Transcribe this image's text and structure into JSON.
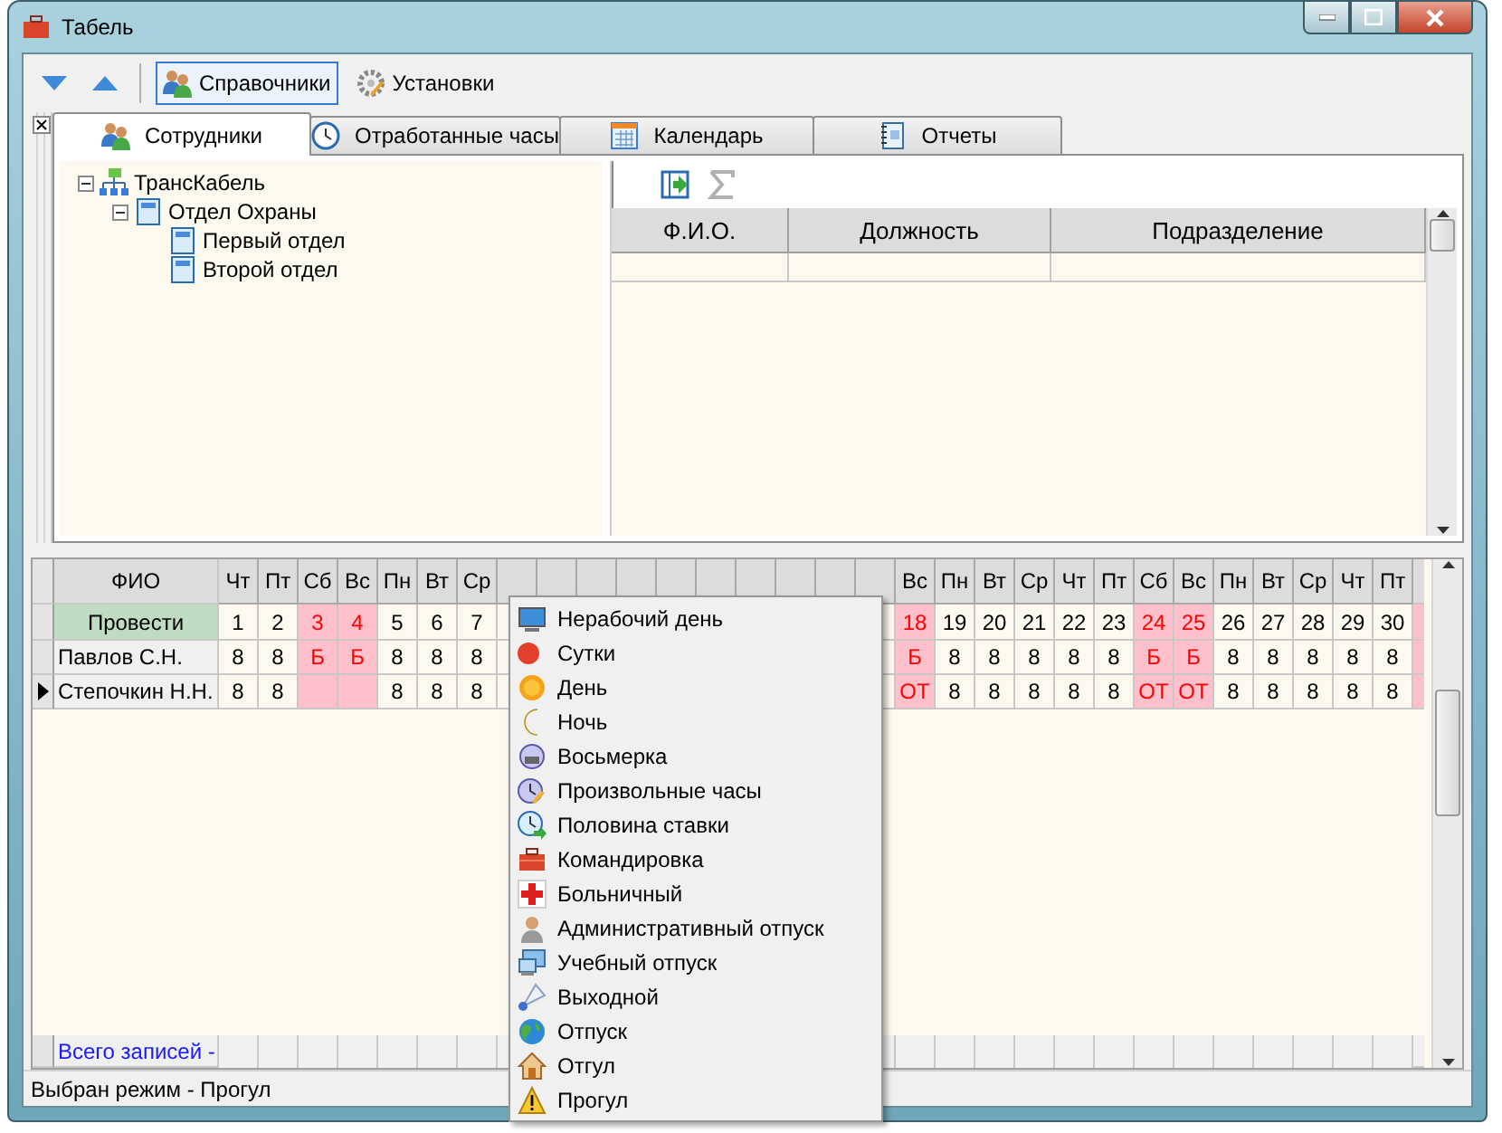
{
  "window": {
    "title": "Табель"
  },
  "toolbar": {
    "buttons": [
      {
        "label": "Справочники",
        "selected": true
      },
      {
        "label": "Установки",
        "selected": false
      }
    ]
  },
  "tabs": [
    {
      "label": "Сотрудники",
      "selected": true
    },
    {
      "label": "Отработанные часы",
      "selected": false
    },
    {
      "label": "Календарь",
      "selected": false
    },
    {
      "label": "Отчеты",
      "selected": false
    }
  ],
  "tree": [
    {
      "label": "ТрансКабель",
      "expanded": true,
      "children": [
        {
          "label": "Отдел Охраны",
          "expanded": true,
          "children": [
            {
              "label": "Первый отдел"
            },
            {
              "label": "Второй отдел"
            }
          ]
        }
      ]
    }
  ],
  "employees_table": {
    "columns": [
      "Ф.И.О.",
      "Должность",
      "Подразделение"
    ]
  },
  "timesheet": {
    "name_header": "ФИО",
    "post_label": "Провести",
    "columns": [
      {
        "header": "Чт",
        "date": "1",
        "weekend": false
      },
      {
        "header": "Пт",
        "date": "2",
        "weekend": false
      },
      {
        "header": "Сб",
        "date": "3",
        "weekend": true
      },
      {
        "header": "Вс",
        "date": "4",
        "weekend": true
      },
      {
        "header": "Пн",
        "date": "5",
        "weekend": false
      },
      {
        "header": "Вт",
        "date": "6",
        "weekend": false
      },
      {
        "header": "Ср",
        "date": "7",
        "weekend": false
      },
      null,
      null,
      null,
      null,
      null,
      null,
      null,
      null,
      null,
      null,
      {
        "header": "Вс",
        "date": "18",
        "weekend": true
      },
      {
        "header": "Пн",
        "date": "19",
        "weekend": false
      },
      {
        "header": "Вт",
        "date": "20",
        "weekend": false
      },
      {
        "header": "Ср",
        "date": "21",
        "weekend": false
      },
      {
        "header": "Чт",
        "date": "22",
        "weekend": false
      },
      {
        "header": "Пт",
        "date": "23",
        "weekend": false
      },
      {
        "header": "Сб",
        "date": "24",
        "weekend": true
      },
      {
        "header": "Вс",
        "date": "25",
        "weekend": true
      },
      {
        "header": "Пн",
        "date": "26",
        "weekend": false
      },
      {
        "header": "Вт",
        "date": "27",
        "weekend": false
      },
      {
        "header": "Ср",
        "date": "28",
        "weekend": false
      },
      {
        "header": "Чт",
        "date": "29",
        "weekend": false
      },
      {
        "header": "Пт",
        "date": "30",
        "weekend": false
      }
    ],
    "rows": [
      {
        "name": "Павлов С.Н.",
        "current": false,
        "cells": [
          "8",
          "8",
          "Б",
          "Б",
          "8",
          "8",
          "8",
          null,
          null,
          null,
          null,
          null,
          null,
          null,
          null,
          null,
          null,
          "Б",
          "8",
          "8",
          "8",
          "8",
          "8",
          "Б",
          "Б",
          "8",
          "8",
          "8",
          "8",
          "8"
        ]
      },
      {
        "name": "Степочкин Н.Н.",
        "current": true,
        "cells": [
          "8",
          "8",
          null,
          null,
          "8",
          "8",
          "8",
          null,
          null,
          null,
          null,
          null,
          null,
          null,
          null,
          null,
          null,
          "ОТ",
          "8",
          "8",
          "8",
          "8",
          "8",
          "ОТ",
          "ОТ",
          "8",
          "8",
          "8",
          "8",
          "8"
        ]
      }
    ],
    "footer": "Всего записей -"
  },
  "context_menu": {
    "items": [
      "Нерабочий день",
      "Сутки",
      "День",
      "Ночь",
      "Восьмерка",
      "Произвольные часы",
      "Половина ставки",
      "Командировка",
      "Больничный",
      "Административный отпуск",
      "Учебный отпуск",
      "Выходной",
      "Отпуск",
      "Отгул",
      "Прогул"
    ]
  },
  "status_bar": "Выбран режим - Прогул"
}
